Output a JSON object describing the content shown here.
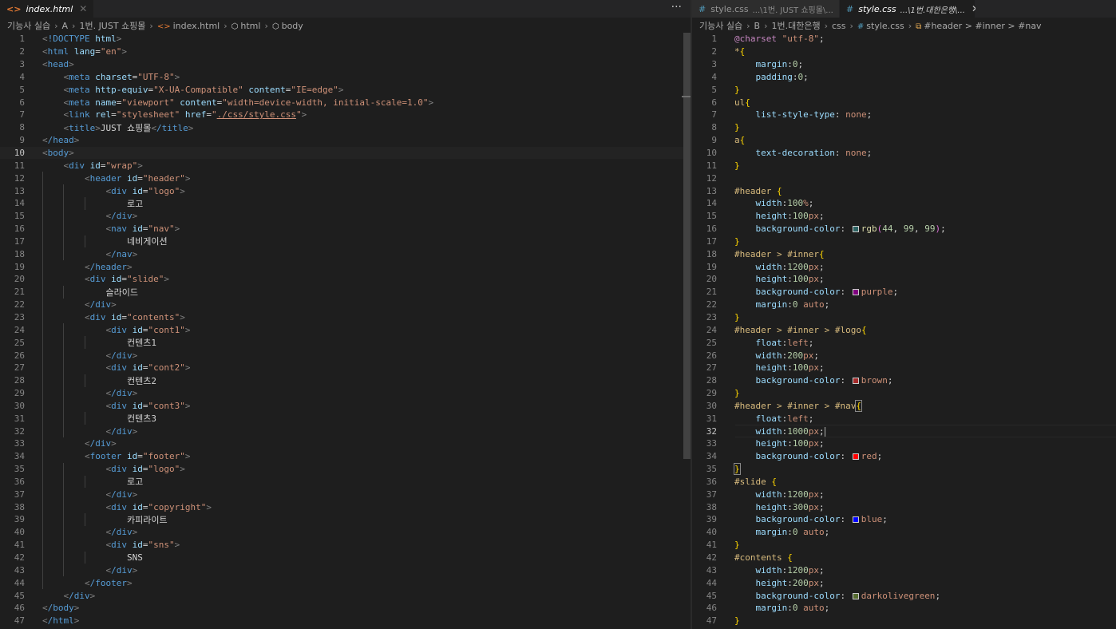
{
  "left": {
    "tab": {
      "label": "index.html",
      "close": "✕"
    },
    "more_actions": "···",
    "breadcrumb": [
      "기능사 실습",
      "A",
      "1번. JUST 쇼핑몰",
      "index.html",
      "html",
      "body"
    ],
    "line_numbers": [
      "1",
      "2",
      "3",
      "4",
      "5",
      "6",
      "7",
      "8",
      "9",
      "10",
      "11",
      "12",
      "13",
      "14",
      "15",
      "16",
      "17",
      "18",
      "19",
      "20",
      "21",
      "22",
      "23",
      "24",
      "25",
      "26",
      "27",
      "28",
      "29",
      "30",
      "31",
      "32",
      "33",
      "34",
      "35",
      "36",
      "37",
      "38",
      "39",
      "40",
      "41",
      "42",
      "43",
      "44",
      "45",
      "46",
      "47"
    ],
    "code_lines": [
      "<!DOCTYPE html>",
      "<html lang=\"en\">",
      "<head>",
      "    <meta charset=\"UTF-8\">",
      "    <meta http-equiv=\"X-UA-Compatible\" content=\"IE=edge\">",
      "    <meta name=\"viewport\" content=\"width=device-width, initial-scale=1.0\">",
      "    <link rel=\"stylesheet\" href=\"./css/style.css\">",
      "    <title>JUST 쇼핑몰</title>",
      "</head>",
      "<body>",
      "    <div id=\"wrap\">",
      "        <header id=\"header\">",
      "            <div id=\"logo\">",
      "                로고",
      "            </div>",
      "            <nav id=\"nav\">",
      "                네비게이션",
      "            </nav>",
      "        </header>",
      "        <div id=\"slide\">",
      "            슬라이드",
      "        </div>",
      "        <div id=\"contents\">",
      "            <div id=\"cont1\">",
      "                컨텐츠1",
      "            </div>",
      "            <div id=\"cont2\">",
      "                컨텐츠2",
      "            </div>",
      "            <div id=\"cont3\">",
      "                컨텐츠3",
      "            </div>",
      "        </div>",
      "        <footer id=\"footer\">",
      "            <div id=\"logo\">",
      "                로고",
      "            </div>",
      "            <div id=\"copyright\">",
      "                카피라이트",
      "            </div>",
      "            <div id=\"sns\">",
      "                SNS",
      "            </div>",
      "        </footer>",
      "    </div>",
      "</body>",
      "</html>"
    ]
  },
  "right": {
    "tabs": [
      {
        "label": "style.css",
        "desc": "...\\1번. JUST 쇼핑몰\\..."
      },
      {
        "label": "style.css",
        "desc": "...\\1번.대한은행\\...",
        "close": "✕"
      }
    ],
    "breadcrumb": [
      "기능사 실습",
      "B",
      "1번.대한은행",
      "css",
      "style.css",
      "#header > #inner > #nav"
    ],
    "line_numbers": [
      "1",
      "2",
      "3",
      "4",
      "5",
      "6",
      "7",
      "8",
      "9",
      "10",
      "11",
      "12",
      "13",
      "14",
      "15",
      "16",
      "17",
      "18",
      "19",
      "20",
      "21",
      "22",
      "23",
      "24",
      "25",
      "26",
      "27",
      "28",
      "29",
      "30",
      "31",
      "32",
      "33",
      "34",
      "35",
      "36",
      "37",
      "38",
      "39",
      "40",
      "41",
      "42",
      "43",
      "44",
      "45",
      "46",
      "47"
    ],
    "code_lines": [
      "@charset \"utf-8\";",
      "*{",
      "    margin:0;",
      "    padding:0;",
      "}",
      "ul{",
      "    list-style-type: none;",
      "}",
      "a{",
      "    text-decoration: none;",
      "}",
      "",
      "#header {",
      "    width:100%;",
      "    height:100px;",
      "    background-color: rgb(44, 99, 99);",
      "}",
      "#header > #inner{",
      "    width:1200px;",
      "    height:100px;",
      "    background-color: purple;",
      "    margin:0 auto;",
      "}",
      "#header > #inner > #logo{",
      "    float:left;",
      "    width:200px;",
      "    height:100px;",
      "    background-color: brown;",
      "}",
      "#header > #inner > #nav{",
      "    float:left;",
      "    width:1000px;",
      "    height:100px;",
      "    background-color: red;",
      "}",
      "#slide {",
      "    width:1200px;",
      "    height:300px;",
      "    background-color: blue;",
      "    margin:0 auto;",
      "}",
      "#contents {",
      "    width:1200px;",
      "    height:200px;",
      "    background-color: darkolivegreen;",
      "    margin:0 auto;",
      "}"
    ],
    "swatch_colors": {
      "rgb(44, 99, 99)": "#2c6363",
      "purple": "#800080",
      "brown": "#a52a2a",
      "red": "#ff0000",
      "blue": "#0000ff",
      "darkolivegreen": "#556b2f"
    }
  },
  "cursor_line": {
    "left": "10",
    "right": "32"
  }
}
